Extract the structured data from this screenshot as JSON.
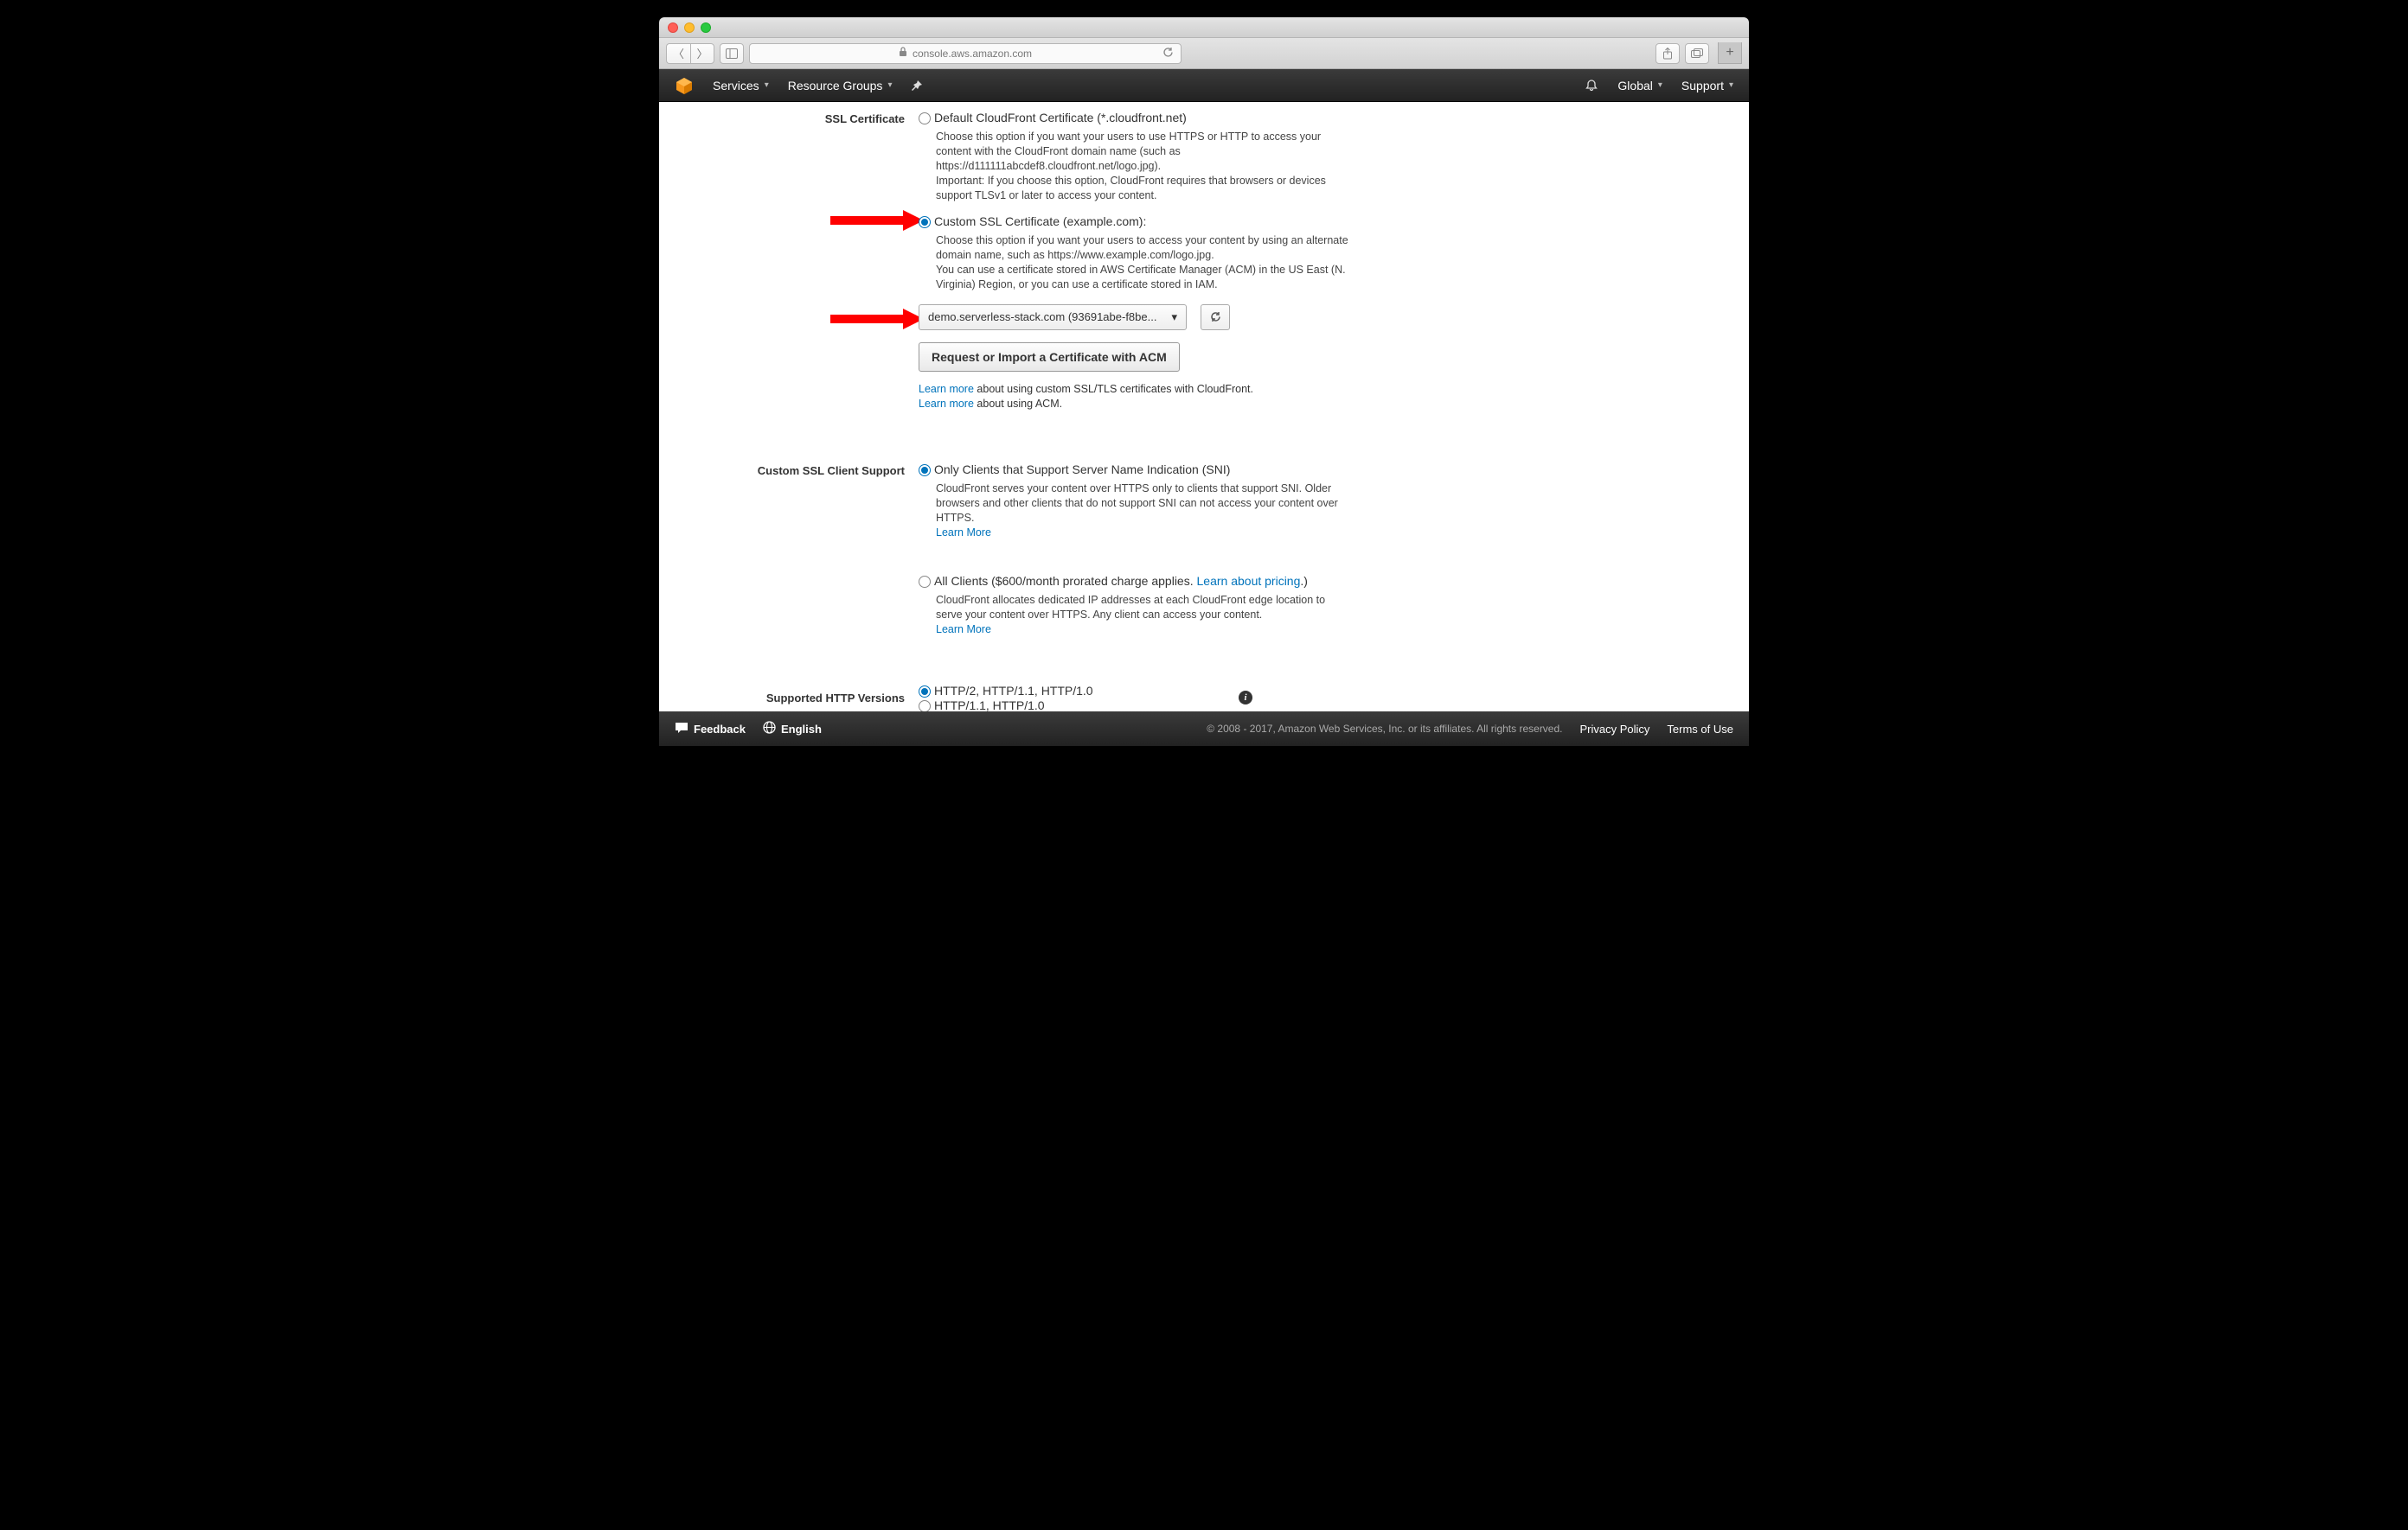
{
  "browser": {
    "url_host": "console.aws.amazon.com"
  },
  "nav": {
    "services": "Services",
    "resource_groups": "Resource Groups",
    "region": "Global",
    "support": "Support"
  },
  "sections": {
    "ssl": {
      "label": "SSL Certificate",
      "default": {
        "label": "Default CloudFront Certificate (*.cloudfront.net)",
        "desc": "Choose this option if you want your users to use HTTPS or HTTP to access your content with the CloudFront domain name (such as https://d111111abcdef8.cloudfront.net/logo.jpg).\nImportant: If you choose this option, CloudFront requires that browsers or devices support TLSv1 or later to access your content."
      },
      "custom": {
        "label": "Custom SSL Certificate (example.com):",
        "desc": "Choose this option if you want your users to access your content by using an alternate domain name, such as https://www.example.com/logo.jpg.\nYou can use a certificate stored in AWS Certificate Manager (ACM) in the US East (N. Virginia) Region, or you can use a certificate stored in IAM.",
        "selected_cert": "demo.serverless-stack.com (93691abe-f8be...",
        "request_btn": "Request or Import a Certificate with ACM",
        "learn1_link": "Learn more",
        "learn1_tail": " about using custom SSL/TLS certificates with CloudFront.",
        "learn2_link": "Learn more",
        "learn2_tail": " about using ACM."
      }
    },
    "client": {
      "label": "Custom SSL Client Support",
      "sni": {
        "label": "Only Clients that Support Server Name Indication (SNI)",
        "desc": "CloudFront serves your content over HTTPS only to clients that support SNI. Older browsers and other clients that do not support SNI can not access your content over HTTPS.",
        "learn": "Learn More"
      },
      "all": {
        "label_pre": "All Clients ($600/month prorated charge applies. ",
        "label_link": "Learn about pricing",
        "label_post": ".)",
        "desc": "CloudFront allocates dedicated IP addresses at each CloudFront edge location to serve your content over HTTPS. Any client can access your content.",
        "learn": "Learn More"
      }
    },
    "http": {
      "label": "Supported HTTP Versions",
      "opt1": "HTTP/2, HTTP/1.1, HTTP/1.0",
      "opt2": "HTTP/1.1, HTTP/1.0"
    }
  },
  "footer": {
    "feedback": "Feedback",
    "language": "English",
    "copyright": "© 2008 - 2017, Amazon Web Services, Inc. or its affiliates. All rights reserved.",
    "privacy": "Privacy Policy",
    "terms": "Terms of Use"
  }
}
